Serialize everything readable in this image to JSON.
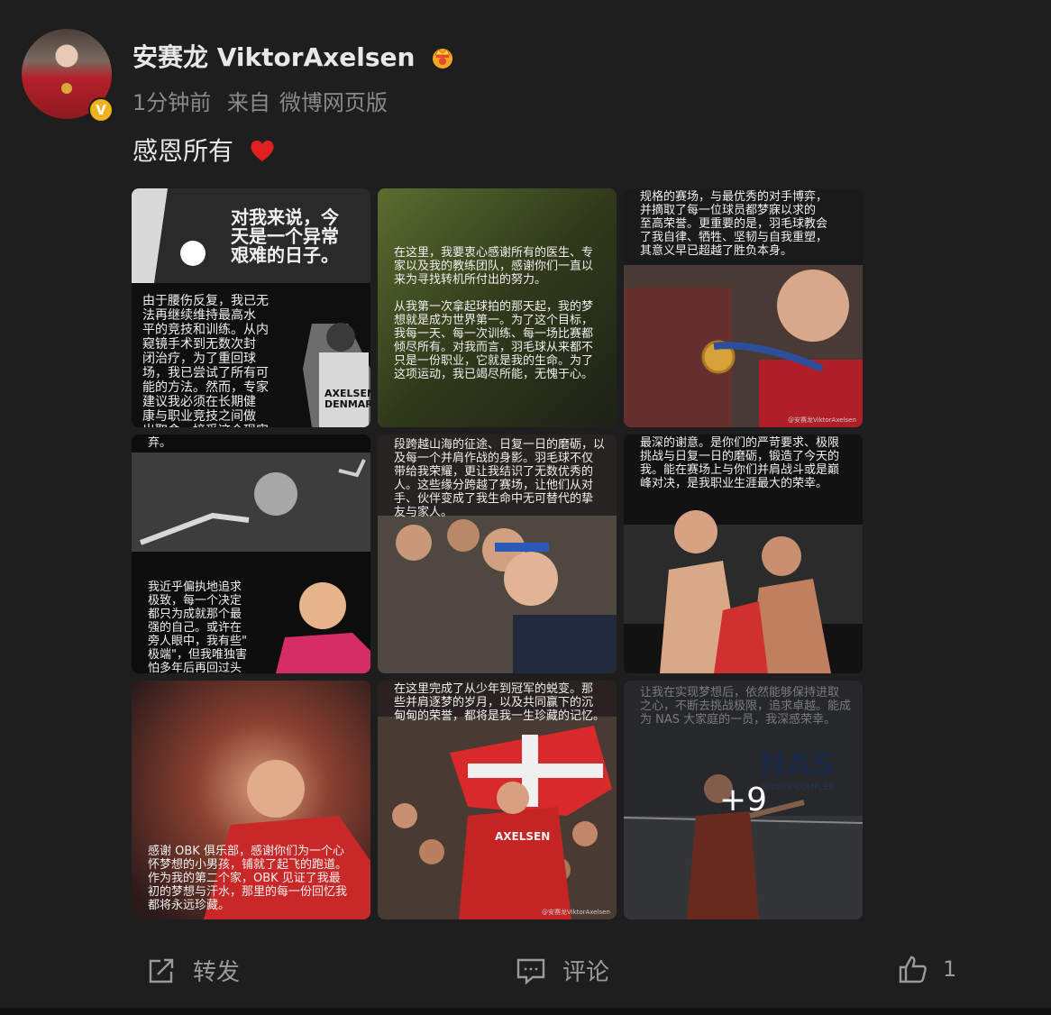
{
  "post": {
    "username": "安赛龙 ViktorAxelsen",
    "time": "1分钟前",
    "source_prefix": "来自",
    "source": "微博网页版",
    "text": "感恩所有"
  },
  "images": {
    "tile1": {
      "headline": "对我来说，今\n天是一个异常\n艰难的日子。",
      "caption": "由于腰伤反复，我已无\n法再继续维持最高水\n平的竞技和训练。从内\n窥镜手术到无数次封\n闭治疗，为了重回球\n场，我已尝试了所有可\n能的方法。然而，专家\n建议我必须在长期健\n康与职业竞技之间做\n出取舍，接受这个现实",
      "jersey": "AXELSEN\nDENMARK"
    },
    "tile2": {
      "caption1": "在这里，我要衷心感谢所有的医生、专\n家以及我的教练团队，感谢你们一直以\n来为寻找转机所付出的努力。",
      "caption2": "从我第一次拿起球拍的那天起，我的梦\n想就是成为世界第一。为了这个目标，\n我每一天、每一次训练、每一场比赛都\n倾尽所有。对我而言，羽毛球从来都不\n只是一份职业，它就是我的生命。为了\n这项运动，我已竭尽所能，无愧于心。"
    },
    "tile3": {
      "caption": "规格的赛场，与最优秀的对手博弈，\n并摘取了每一位球员都梦寐以求的\n至高荣誉。更重要的是，羽毛球教会\n了我自律、牺牲、坚韧与自我重塑，\n其意义早已超越了胜负本身。",
      "watermark": "@安赛龙ViktorAxelsen"
    },
    "tile4": {
      "caption_top": "弃。",
      "caption": "我近乎偏执地追求\n极致，每一个决定\n都只为成就那个最\n强的自己。或许在\n旁人眼中，我有些\"\n极端\"，但我唯独害\n怕多年后再回过头"
    },
    "tile5": {
      "caption": "段跨越山海的征途、日复一日的磨砺，以\n及每一个并肩作战的身影。羽毛球不仅\n带给我荣耀，更让我结识了无数优秀的\n人。这些缘分跨越了赛场，让他们从对\n手、伙伴变成了我生命中无可替代的挚\n友与家人。"
    },
    "tile6": {
      "caption": "最深的谢意。是你们的严苛要求、极限\n挑战与日复一日的磨砺，锻造了今天的\n我。能在赛场上与你们并肩战斗或是巅\n峰对决，是我职业生涯最大的荣幸。"
    },
    "tile7": {
      "caption": "感谢 OBK 俱乐部，感谢你们为一个心\n怀梦想的小男孩，铺就了起飞的跑道。\n作为我的第二个家，OBK 见证了我最\n初的梦想与汗水，那里的每一份回忆我\n都将永远珍藏。"
    },
    "tile8": {
      "caption": "在这里完成了从少年到冠军的蜕变。那\n些并肩逐梦的岁月，以及共同赢下的沉\n甸甸的荣誉，都将是我一生珍藏的记忆。",
      "jersey": "AXELSEN",
      "watermark": "@安赛龙ViktorAxelsen"
    },
    "tile9": {
      "caption": "让我在实现梦想后，依然能够保持进取\n之心，不断去挑战极限，追求卓越。能成\n为 NAS 大家庭的一员，我深感荣幸。",
      "logo": "NAS",
      "logo_sub": "SPORTS COMPLEX",
      "more_count": "+9"
    }
  },
  "actions": {
    "repost": "转发",
    "comment": "评论",
    "like_count": "1"
  },
  "colors": {
    "background": "#1e1e1e",
    "muted_text": "#8a8a8a",
    "verify_badge": "#f2b21b",
    "heart": "#e02020"
  },
  "icons": [
    "crown-icon",
    "verified-badge-icon",
    "heart-icon",
    "repost-icon",
    "comment-icon",
    "like-icon"
  ]
}
